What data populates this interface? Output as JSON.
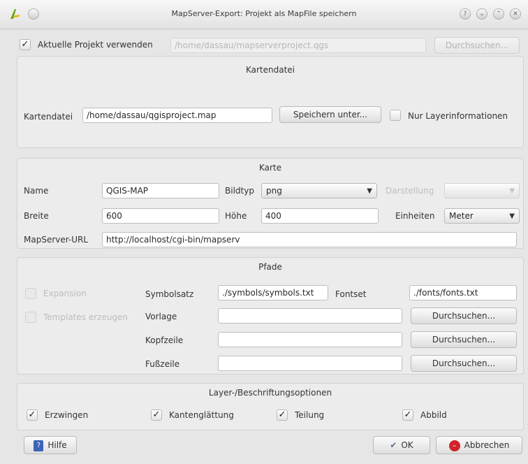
{
  "window": {
    "title": "MapServer-Export: Projekt als MapFile speichern",
    "help_glyph": "?",
    "min_glyph": "⌄",
    "max_glyph": "⌃",
    "close_glyph": "✕"
  },
  "project": {
    "checkbox_label": "Aktuelle Projekt verwenden",
    "checked_glyph": "✓",
    "path_value": "/home/dassau/mapserverproject.qgs",
    "browse_label": "Durchsuchen..."
  },
  "kartendatei": {
    "title": "Kartendatei",
    "label": "Kartendatei",
    "value": "/home/dassau/qgisproject.map",
    "save_as_label": "Speichern unter...",
    "layer_only_label": "Nur Layerinformationen"
  },
  "karte": {
    "title": "Karte",
    "name_label": "Name",
    "name_value": "QGIS-MAP",
    "bildtyp_label": "Bildtyp",
    "bildtyp_value": "png",
    "darstellung_label": "Darstellung",
    "breite_label": "Breite",
    "breite_value": "600",
    "hoehe_label": "Höhe",
    "hoehe_value": "400",
    "einheiten_label": "Einheiten",
    "einheiten_value": "Meter",
    "url_label": "MapServer-URL",
    "url_value": "http://localhost/cgi-bin/mapserv"
  },
  "pfade": {
    "title": "Pfade",
    "expansion_label": "Expansion",
    "template_label": "Templates erzeugen",
    "symbolsatz_label": "Symbolsatz",
    "symbolsatz_value": "./symbols/symbols.txt",
    "fontset_label": "Fontset",
    "fontset_value": "./fonts/fonts.txt",
    "vorlage_label": "Vorlage",
    "kopfzeile_label": "Kopfzeile",
    "fusszeile_label": "Fußzeile",
    "browse_label": "Durchsuchen..."
  },
  "layer_opts": {
    "title": "Layer-/Beschriftungsoptionen",
    "erzwingen_label": "Erzwingen",
    "kanten_label": "Kantenglättung",
    "teilung_label": "Teilung",
    "abbild_label": "Abbild",
    "checked_glyph": "✓"
  },
  "footer": {
    "help_label": "Hilfe",
    "ok_label": "OK",
    "cancel_label": "Abbrechen",
    "ok_glyph": "✔",
    "cancel_glyph": "⊘"
  },
  "colors": {
    "cancel_icon": "#d0232b",
    "help_icon": "#3a64b5",
    "logo_green": "#6aa31f"
  }
}
